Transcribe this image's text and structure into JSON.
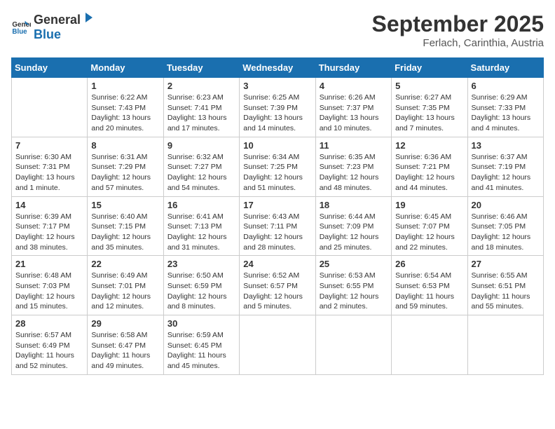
{
  "logo": {
    "text_general": "General",
    "text_blue": "Blue"
  },
  "header": {
    "month": "September 2025",
    "location": "Ferlach, Carinthia, Austria"
  },
  "days_of_week": [
    "Sunday",
    "Monday",
    "Tuesday",
    "Wednesday",
    "Thursday",
    "Friday",
    "Saturday"
  ],
  "weeks": [
    [
      {
        "day": "",
        "info": ""
      },
      {
        "day": "1",
        "info": "Sunrise: 6:22 AM\nSunset: 7:43 PM\nDaylight: 13 hours\nand 20 minutes."
      },
      {
        "day": "2",
        "info": "Sunrise: 6:23 AM\nSunset: 7:41 PM\nDaylight: 13 hours\nand 17 minutes."
      },
      {
        "day": "3",
        "info": "Sunrise: 6:25 AM\nSunset: 7:39 PM\nDaylight: 13 hours\nand 14 minutes."
      },
      {
        "day": "4",
        "info": "Sunrise: 6:26 AM\nSunset: 7:37 PM\nDaylight: 13 hours\nand 10 minutes."
      },
      {
        "day": "5",
        "info": "Sunrise: 6:27 AM\nSunset: 7:35 PM\nDaylight: 13 hours\nand 7 minutes."
      },
      {
        "day": "6",
        "info": "Sunrise: 6:29 AM\nSunset: 7:33 PM\nDaylight: 13 hours\nand 4 minutes."
      }
    ],
    [
      {
        "day": "7",
        "info": "Sunrise: 6:30 AM\nSunset: 7:31 PM\nDaylight: 13 hours\nand 1 minute."
      },
      {
        "day": "8",
        "info": "Sunrise: 6:31 AM\nSunset: 7:29 PM\nDaylight: 12 hours\nand 57 minutes."
      },
      {
        "day": "9",
        "info": "Sunrise: 6:32 AM\nSunset: 7:27 PM\nDaylight: 12 hours\nand 54 minutes."
      },
      {
        "day": "10",
        "info": "Sunrise: 6:34 AM\nSunset: 7:25 PM\nDaylight: 12 hours\nand 51 minutes."
      },
      {
        "day": "11",
        "info": "Sunrise: 6:35 AM\nSunset: 7:23 PM\nDaylight: 12 hours\nand 48 minutes."
      },
      {
        "day": "12",
        "info": "Sunrise: 6:36 AM\nSunset: 7:21 PM\nDaylight: 12 hours\nand 44 minutes."
      },
      {
        "day": "13",
        "info": "Sunrise: 6:37 AM\nSunset: 7:19 PM\nDaylight: 12 hours\nand 41 minutes."
      }
    ],
    [
      {
        "day": "14",
        "info": "Sunrise: 6:39 AM\nSunset: 7:17 PM\nDaylight: 12 hours\nand 38 minutes."
      },
      {
        "day": "15",
        "info": "Sunrise: 6:40 AM\nSunset: 7:15 PM\nDaylight: 12 hours\nand 35 minutes."
      },
      {
        "day": "16",
        "info": "Sunrise: 6:41 AM\nSunset: 7:13 PM\nDaylight: 12 hours\nand 31 minutes."
      },
      {
        "day": "17",
        "info": "Sunrise: 6:43 AM\nSunset: 7:11 PM\nDaylight: 12 hours\nand 28 minutes."
      },
      {
        "day": "18",
        "info": "Sunrise: 6:44 AM\nSunset: 7:09 PM\nDaylight: 12 hours\nand 25 minutes."
      },
      {
        "day": "19",
        "info": "Sunrise: 6:45 AM\nSunset: 7:07 PM\nDaylight: 12 hours\nand 22 minutes."
      },
      {
        "day": "20",
        "info": "Sunrise: 6:46 AM\nSunset: 7:05 PM\nDaylight: 12 hours\nand 18 minutes."
      }
    ],
    [
      {
        "day": "21",
        "info": "Sunrise: 6:48 AM\nSunset: 7:03 PM\nDaylight: 12 hours\nand 15 minutes."
      },
      {
        "day": "22",
        "info": "Sunrise: 6:49 AM\nSunset: 7:01 PM\nDaylight: 12 hours\nand 12 minutes."
      },
      {
        "day": "23",
        "info": "Sunrise: 6:50 AM\nSunset: 6:59 PM\nDaylight: 12 hours\nand 8 minutes."
      },
      {
        "day": "24",
        "info": "Sunrise: 6:52 AM\nSunset: 6:57 PM\nDaylight: 12 hours\nand 5 minutes."
      },
      {
        "day": "25",
        "info": "Sunrise: 6:53 AM\nSunset: 6:55 PM\nDaylight: 12 hours\nand 2 minutes."
      },
      {
        "day": "26",
        "info": "Sunrise: 6:54 AM\nSunset: 6:53 PM\nDaylight: 11 hours\nand 59 minutes."
      },
      {
        "day": "27",
        "info": "Sunrise: 6:55 AM\nSunset: 6:51 PM\nDaylight: 11 hours\nand 55 minutes."
      }
    ],
    [
      {
        "day": "28",
        "info": "Sunrise: 6:57 AM\nSunset: 6:49 PM\nDaylight: 11 hours\nand 52 minutes."
      },
      {
        "day": "29",
        "info": "Sunrise: 6:58 AM\nSunset: 6:47 PM\nDaylight: 11 hours\nand 49 minutes."
      },
      {
        "day": "30",
        "info": "Sunrise: 6:59 AM\nSunset: 6:45 PM\nDaylight: 11 hours\nand 45 minutes."
      },
      {
        "day": "",
        "info": ""
      },
      {
        "day": "",
        "info": ""
      },
      {
        "day": "",
        "info": ""
      },
      {
        "day": "",
        "info": ""
      }
    ]
  ]
}
